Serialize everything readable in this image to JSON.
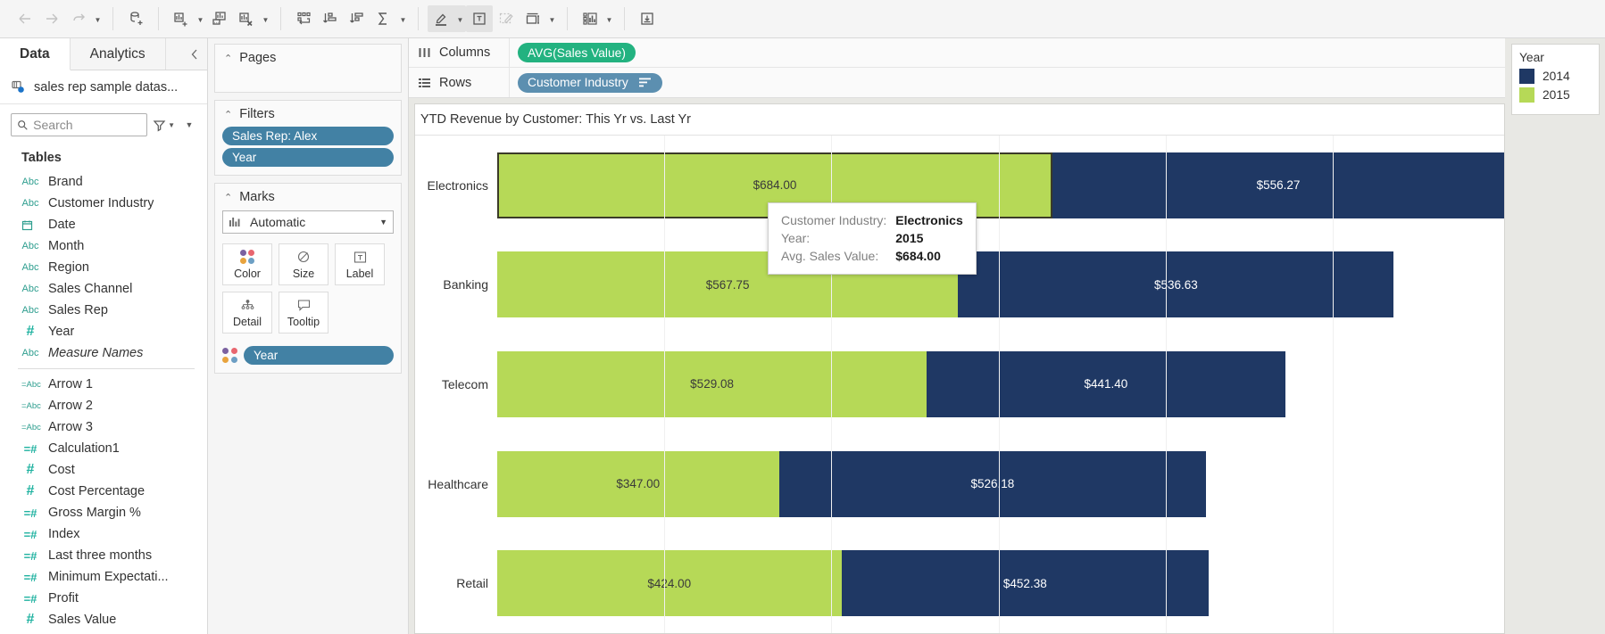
{
  "toolbar": {
    "groups": [
      {
        "buttons": [
          {
            "name": "back-button",
            "icon": "arrow-left-icon",
            "disabled": true,
            "caret": false
          },
          {
            "name": "forward-button",
            "icon": "arrow-right-icon",
            "disabled": true,
            "caret": false
          },
          {
            "name": "undo-redo-button",
            "icon": "redo-icon",
            "disabled": false,
            "caret": true
          }
        ]
      },
      {
        "buttons": [
          {
            "name": "new-data-source-button",
            "icon": "database-plus-icon",
            "disabled": false,
            "caret": false
          }
        ]
      },
      {
        "buttons": [
          {
            "name": "new-worksheet-button",
            "icon": "chart-plus-icon",
            "disabled": false,
            "caret": true
          },
          {
            "name": "duplicate-sheet-button",
            "icon": "chart-duplicate-icon",
            "disabled": false,
            "caret": false
          },
          {
            "name": "clear-sheet-button",
            "icon": "chart-clear-icon",
            "disabled": false,
            "caret": true
          }
        ]
      },
      {
        "buttons": [
          {
            "name": "swap-rows-columns-button",
            "icon": "swap-icon",
            "disabled": false,
            "caret": false
          },
          {
            "name": "sort-ascending-button",
            "icon": "sort-asc-icon",
            "disabled": false,
            "caret": false
          },
          {
            "name": "sort-descending-button",
            "icon": "sort-desc-icon",
            "disabled": false,
            "caret": false
          },
          {
            "name": "totals-button",
            "icon": "sigma-icon",
            "disabled": false,
            "caret": true
          }
        ]
      },
      {
        "buttons": [
          {
            "name": "highlighter-button",
            "icon": "highlighter-icon",
            "disabled": false,
            "caret": true,
            "active": true
          },
          {
            "name": "show-labels-button",
            "icon": "text-label-icon",
            "disabled": false,
            "caret": false,
            "active": true
          },
          {
            "name": "presentation-mode-button",
            "icon": "annotate-icon",
            "disabled": true,
            "caret": false
          },
          {
            "name": "fit-button",
            "icon": "fit-icon",
            "disabled": false,
            "caret": true
          }
        ]
      },
      {
        "buttons": [
          {
            "name": "show-me-button",
            "icon": "show-me-icon",
            "disabled": false,
            "caret": true
          }
        ]
      },
      {
        "buttons": [
          {
            "name": "download-button",
            "icon": "download-icon",
            "disabled": false,
            "caret": false
          }
        ]
      }
    ]
  },
  "left_pane": {
    "tabs": [
      {
        "label": "Data",
        "selected": true
      },
      {
        "label": "Analytics",
        "selected": false
      }
    ],
    "collapse_icon": "chevron-left-icon",
    "data_source": "sales rep sample datas...",
    "search": {
      "placeholder": "Search",
      "value": ""
    },
    "filter_icon": "funnel-icon",
    "more_icon": "chevron-down-icon",
    "group_title": "Tables",
    "fields": [
      {
        "label": "Brand",
        "type": "Abc",
        "italic": false,
        "calc": false
      },
      {
        "label": "Customer Industry",
        "type": "Abc",
        "italic": false,
        "calc": false
      },
      {
        "label": "Date",
        "type": "date",
        "italic": false,
        "calc": false
      },
      {
        "label": "Month",
        "type": "Abc",
        "italic": false,
        "calc": false
      },
      {
        "label": "Region",
        "type": "Abc",
        "italic": false,
        "calc": false
      },
      {
        "label": "Sales Channel",
        "type": "Abc",
        "italic": false,
        "calc": false
      },
      {
        "label": "Sales Rep",
        "type": "Abc",
        "italic": false,
        "calc": false
      },
      {
        "label": "Year",
        "type": "num",
        "italic": false,
        "calc": false
      },
      {
        "label": "Measure Names",
        "type": "Abc",
        "italic": true,
        "calc": false
      },
      {
        "separator": true
      },
      {
        "label": "Arrow 1",
        "type": "Abc",
        "italic": false,
        "calc": true
      },
      {
        "label": "Arrow 2",
        "type": "Abc",
        "italic": false,
        "calc": true
      },
      {
        "label": "Arrow 3",
        "type": "Abc",
        "italic": false,
        "calc": true
      },
      {
        "label": "Calculation1",
        "type": "num",
        "italic": false,
        "calc": true
      },
      {
        "label": "Cost",
        "type": "num",
        "italic": false,
        "calc": false
      },
      {
        "label": "Cost Percentage",
        "type": "num",
        "italic": false,
        "calc": false
      },
      {
        "label": "Gross Margin %",
        "type": "num",
        "italic": false,
        "calc": true
      },
      {
        "label": "Index",
        "type": "num",
        "italic": false,
        "calc": true
      },
      {
        "label": "Last three months",
        "type": "num",
        "italic": false,
        "calc": true
      },
      {
        "label": "Minimum Expectati...",
        "type": "num",
        "italic": false,
        "calc": true
      },
      {
        "label": "Profit",
        "type": "num",
        "italic": false,
        "calc": true
      },
      {
        "label": "Sales Value",
        "type": "num",
        "italic": false,
        "calc": false
      }
    ]
  },
  "cards": {
    "pages": {
      "title": "Pages",
      "items": []
    },
    "filters": {
      "title": "Filters",
      "items": [
        "Sales Rep: Alex",
        "Year"
      ]
    },
    "marks": {
      "title": "Marks",
      "mark_type": "Automatic",
      "mark_type_icon": "bar-chart-icon",
      "buttons": [
        {
          "label": "Color",
          "icon": "color-dots-icon"
        },
        {
          "label": "Size",
          "icon": "size-circle-icon"
        },
        {
          "label": "Label",
          "icon": "label-icon"
        },
        {
          "label": "Detail",
          "icon": "detail-icon"
        },
        {
          "label": "Tooltip",
          "icon": "tooltip-icon"
        }
      ],
      "encodings": [
        {
          "label": "Year",
          "encoding_icon": "color-dots-icon"
        }
      ]
    }
  },
  "shelves": [
    {
      "label": "Columns",
      "icon": "columns-icon",
      "pills": [
        {
          "label": "AVG(Sales Value)",
          "color": "green",
          "sort_icon": false
        }
      ]
    },
    {
      "label": "Rows",
      "icon": "rows-icon",
      "pills": [
        {
          "label": "Customer Industry",
          "color": "steel",
          "sort_icon": true
        }
      ]
    }
  ],
  "worksheet": {
    "title": "YTD Revenue by Customer: This Yr vs. Last Yr"
  },
  "tooltip": {
    "rows": [
      {
        "key": "Customer Industry:",
        "value": "Electronics"
      },
      {
        "key": "Year:",
        "value": "2015"
      },
      {
        "key": "Avg. Sales Value:",
        "value": "$684.00"
      }
    ]
  },
  "legend": {
    "title": "Year",
    "items": [
      {
        "label": "2014",
        "color": "#1f3864"
      },
      {
        "label": "2015",
        "color": "#b6d957"
      }
    ]
  },
  "chart_data": {
    "type": "bar",
    "title": "YTD Revenue by Customer: This Yr vs. Last Yr",
    "orientation": "horizontal",
    "stacked": true,
    "xlabel": "",
    "ylabel": "Customer Industry",
    "categories": [
      "Electronics",
      "Banking",
      "Telecom",
      "Healthcare",
      "Retail"
    ],
    "series": [
      {
        "name": "2015",
        "color": "#b6d957",
        "values": [
          684.0,
          567.75,
          529.08,
          347.0,
          424.0
        ],
        "labels": [
          "$684.00",
          "$567.75",
          "$529.08",
          "$347.00",
          "$424.00"
        ]
      },
      {
        "name": "2014",
        "color": "#1f3864",
        "values": [
          556.27,
          536.63,
          441.4,
          526.18,
          452.38
        ],
        "labels": [
          "$556.27",
          "$536.63",
          "$441.40",
          "$526.18",
          "$452.38"
        ]
      }
    ],
    "totals": [
      1240.27,
      1104.38,
      970.48,
      873.18,
      876.38
    ],
    "axis_max": 1240.27,
    "grid": true,
    "legend": {
      "title": "Year",
      "position": "right",
      "entries": [
        "2014",
        "2015"
      ]
    },
    "selected_mark": {
      "category": "Electronics",
      "series": "2015",
      "value": 684.0
    }
  }
}
